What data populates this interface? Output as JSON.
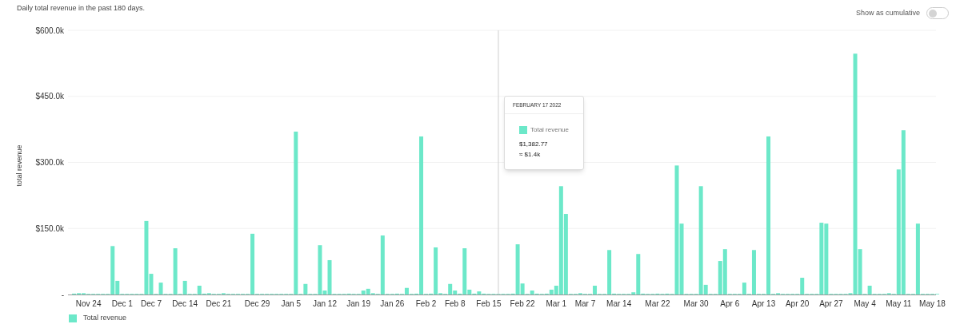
{
  "subtitle": "Daily total revenue in the past 180 days.",
  "cumulative_toggle": {
    "label": "Show as cumulative",
    "on": false
  },
  "chart_data": {
    "type": "bar",
    "ylabel": "total revenue",
    "categories": [
      null,
      null,
      null,
      "Nov 24",
      null,
      null,
      null,
      null,
      null,
      null,
      "Dec 1",
      null,
      null,
      null,
      null,
      null,
      "Dec 7",
      null,
      null,
      null,
      null,
      null,
      null,
      "Dec 14",
      null,
      null,
      null,
      null,
      null,
      null,
      "Dec 21",
      null,
      null,
      null,
      null,
      null,
      null,
      null,
      "Dec 29",
      null,
      null,
      null,
      null,
      null,
      null,
      "Jan 5",
      null,
      null,
      null,
      null,
      null,
      null,
      "Jan 12",
      null,
      null,
      null,
      null,
      null,
      null,
      "Jan 19",
      null,
      null,
      null,
      null,
      null,
      null,
      "Jan 26",
      null,
      null,
      null,
      null,
      null,
      null,
      "Feb 2",
      null,
      null,
      null,
      null,
      null,
      "Feb 8",
      null,
      null,
      null,
      null,
      null,
      null,
      "Feb 15",
      null,
      null,
      null,
      null,
      null,
      null,
      "Feb 22",
      null,
      null,
      null,
      null,
      null,
      null,
      "Mar 1",
      null,
      null,
      null,
      null,
      null,
      "Mar 7",
      null,
      null,
      null,
      null,
      null,
      null,
      "Mar 14",
      null,
      null,
      null,
      null,
      null,
      null,
      null,
      "Mar 22",
      null,
      null,
      null,
      null,
      null,
      null,
      null,
      "Mar 30",
      null,
      null,
      null,
      null,
      null,
      null,
      "Apr 6",
      null,
      null,
      null,
      null,
      null,
      null,
      "Apr 13",
      null,
      null,
      null,
      null,
      null,
      null,
      "Apr 20",
      null,
      null,
      null,
      null,
      null,
      null,
      "Apr 27",
      null,
      null,
      null,
      null,
      null,
      null,
      "May 4",
      null,
      null,
      null,
      null,
      null,
      null,
      "May 11",
      null,
      null,
      null,
      null,
      null,
      null,
      "May 18",
      null
    ],
    "grid": true,
    "series": [
      {
        "name": "Total revenue",
        "color": "#6ce8c9",
        "values": [
          2,
          3,
          3,
          0,
          0,
          0,
          0,
          0,
          110,
          31,
          0,
          0,
          0,
          0,
          1,
          167,
          47,
          0,
          27,
          0,
          0,
          105,
          0,
          31,
          0,
          0,
          20,
          2,
          3,
          0,
          0,
          3,
          0,
          0,
          0,
          0,
          0,
          138,
          0,
          0,
          0,
          0,
          0,
          0,
          0,
          0,
          370,
          0,
          24,
          0,
          0,
          112,
          9,
          78,
          0,
          1,
          0,
          2,
          0,
          0,
          9,
          13,
          3,
          0,
          134,
          0,
          0,
          2,
          0,
          15,
          0,
          2,
          359,
          0,
          2,
          107,
          3,
          0,
          24,
          9,
          2,
          105,
          11,
          2,
          7,
          2,
          0,
          0,
          1,
          0,
          1,
          2,
          114,
          25,
          0,
          9,
          2,
          0,
          2,
          11,
          20,
          246,
          183,
          0,
          0,
          3,
          0,
          0,
          20,
          0,
          0,
          101,
          2,
          0,
          0,
          0,
          5,
          92,
          2,
          0,
          0,
          2,
          0,
          2,
          0,
          293,
          161,
          0,
          0,
          0,
          246,
          22,
          0,
          0,
          76,
          103,
          0,
          0,
          1,
          27,
          0,
          101,
          0,
          0,
          359,
          0,
          3,
          0,
          0,
          1,
          0,
          38,
          0,
          0,
          0,
          163,
          161,
          0,
          0,
          0,
          1,
          3,
          547,
          103,
          0,
          20,
          0,
          0,
          0,
          3,
          0,
          284,
          373,
          0,
          1,
          161,
          0,
          0,
          0,
          0
        ]
      }
    ],
    "ylim": [
      0,
      600
    ],
    "yticks": [
      {
        "value": 0,
        "label": "-"
      },
      {
        "value": 150,
        "label": "$150.0k"
      },
      {
        "value": 300,
        "label": "$300.0k"
      },
      {
        "value": 450,
        "label": "$450.0k"
      },
      {
        "value": 600,
        "label": "$600.0k"
      }
    ]
  },
  "tooltip": {
    "date": "FEBRUARY 17 2022",
    "series_name": "Total revenue",
    "value": "$1,382.77",
    "approx": "≈ $1.4k"
  }
}
